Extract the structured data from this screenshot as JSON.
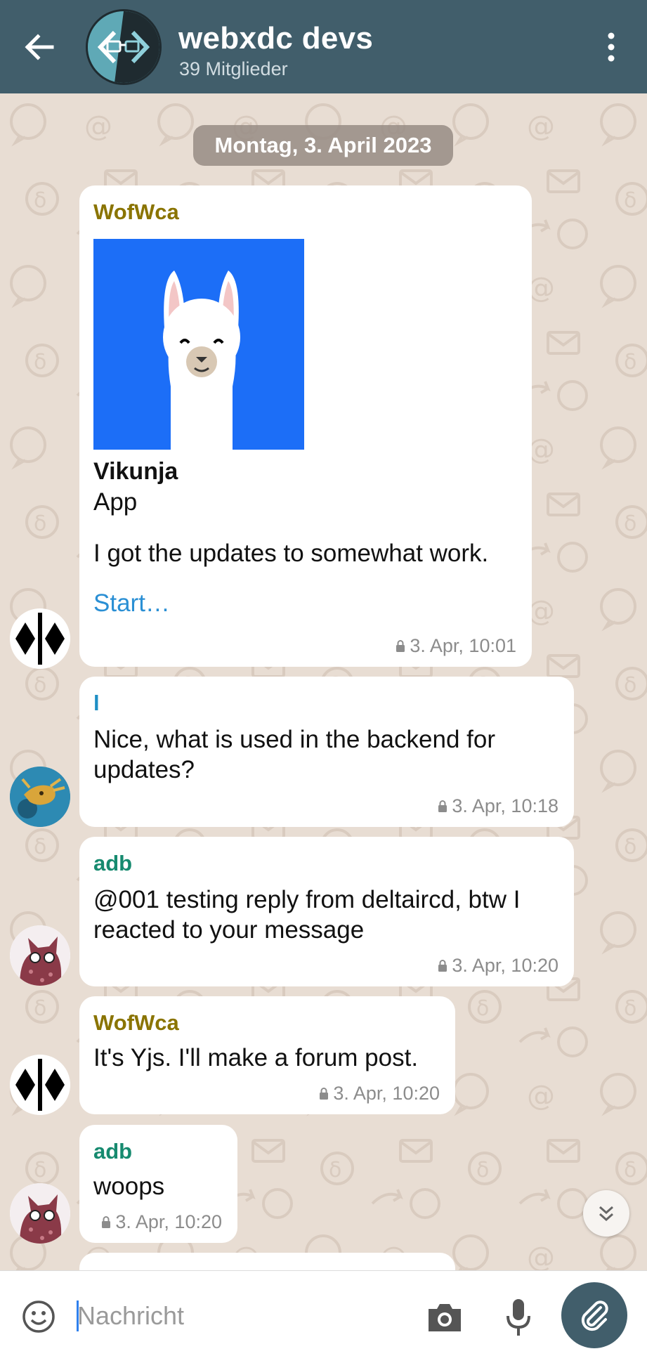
{
  "header": {
    "title": "webxdc devs",
    "subtitle": "39 Mitglieder"
  },
  "date_separator": "Montag, 3. April 2023",
  "messages": [
    {
      "sender": "WofWca",
      "app_name": "Vikunja",
      "app_type": "App",
      "text": "I got the updates to somewhat work.",
      "action": "Start…",
      "time": "3. Apr, 10:01"
    },
    {
      "sender": "l",
      "text": "Nice, what is used in the backend for updates?",
      "time": "3. Apr, 10:18"
    },
    {
      "sender": "adb",
      "text": "@001 testing reply from deltaircd, btw I reacted to your message",
      "time": "3. Apr, 10:20"
    },
    {
      "sender": "WofWca",
      "text": "It's Yjs. I'll make a forum post.",
      "time": "3. Apr, 10:20"
    },
    {
      "sender": "adb",
      "text": "woops",
      "time": "3. Apr, 10:20"
    }
  ],
  "composer": {
    "placeholder": "Nachricht"
  },
  "colors": {
    "header_bg": "#415e6b",
    "wallpaper": "#e8ddd3",
    "sender_wofwca": "#8a7400",
    "sender_l": "#1e8fc4",
    "sender_adb": "#168a6f",
    "link": "#2a8fd4"
  },
  "icons": {
    "back": "arrow-left-icon",
    "menu": "more-vertical-icon",
    "lock": "lock-icon",
    "emoji": "smiley-icon",
    "camera": "camera-icon",
    "mic": "microphone-icon",
    "attach": "paperclip-icon",
    "scroll": "chevron-double-down-icon"
  }
}
